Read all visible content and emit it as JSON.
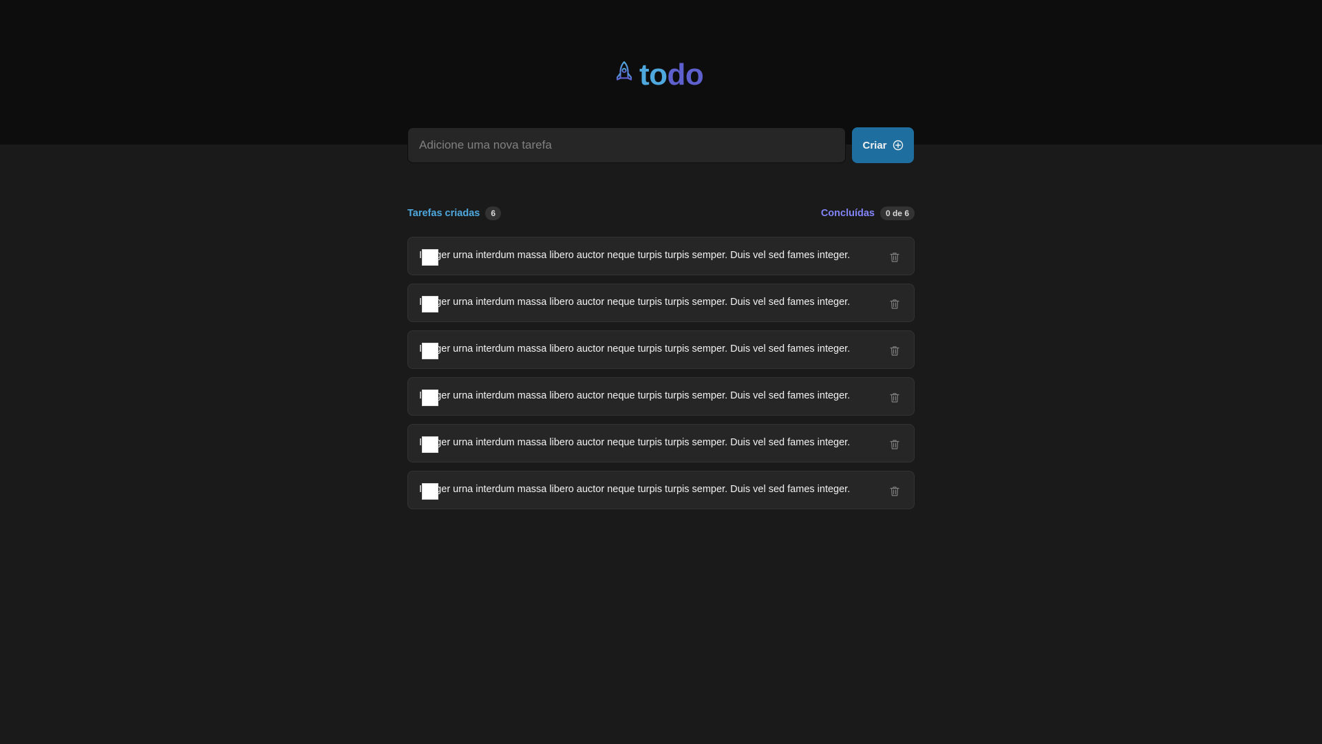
{
  "header": {
    "logo_part1": "to",
    "logo_part2": "do",
    "logo_icon": "rocket-icon"
  },
  "form": {
    "placeholder": "Adicione uma nova tarefa",
    "value": "",
    "create_label": "Criar",
    "create_icon": "plus-circle-icon"
  },
  "summary": {
    "created_label": "Tarefas criadas",
    "created_count": "6",
    "done_label": "Concluídas",
    "done_count": "0 de 6"
  },
  "tasks": [
    {
      "text": "Integer urna interdum massa libero auctor neque turpis turpis semper. Duis vel sed fames integer.",
      "done": false
    },
    {
      "text": "Integer urna interdum massa libero auctor neque turpis turpis semper. Duis vel sed fames integer.",
      "done": false
    },
    {
      "text": "Integer urna interdum massa libero auctor neque turpis turpis semper. Duis vel sed fames integer.",
      "done": false
    },
    {
      "text": "Integer urna interdum massa libero auctor neque turpis turpis semper. Duis vel sed fames integer.",
      "done": false
    },
    {
      "text": "Integer urna interdum massa libero auctor neque turpis turpis semper. Duis vel sed fames integer.",
      "done": false
    },
    {
      "text": "Integer urna interdum massa libero auctor neque turpis turpis semper. Duis vel sed fames integer.",
      "done": false
    }
  ],
  "colors": {
    "header_bg": "#0d0d0d",
    "page_bg": "#1a1a1a",
    "card_bg": "#262626",
    "blue": "#4ea8de",
    "blue_dark": "#1e6f9f",
    "purple": "#8284fa",
    "purple_dark": "#5e60ce"
  }
}
